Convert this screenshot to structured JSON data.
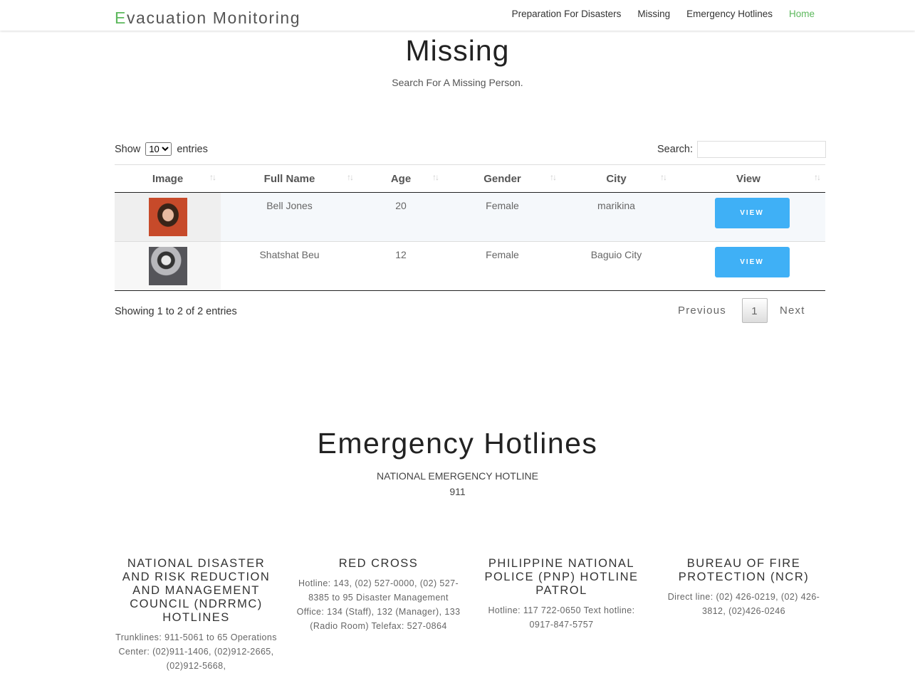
{
  "nav": {
    "brand_first": "E",
    "brand_rest": "vacuation Monitoring",
    "items": [
      "Preparation For Disasters",
      "Missing",
      "Emergency Hotlines",
      "Home"
    ],
    "active_color": "#5cb85c"
  },
  "missing": {
    "title": "Missing",
    "subtitle": "Search For A Missing Person.",
    "length": {
      "show": "Show",
      "entries": "entries",
      "selected": "10"
    },
    "search_label": "Search:",
    "columns": [
      "Image",
      "Full Name",
      "Age",
      "Gender",
      "City",
      "View"
    ],
    "rows": [
      {
        "name": "Bell  Jones",
        "age": "20",
        "gender": "Female",
        "city": "marikina",
        "view": "VIEW"
      },
      {
        "name": "Shatshat  Beu",
        "age": "12",
        "gender": "Female",
        "city": "Baguio City",
        "view": "VIEW"
      }
    ],
    "info": "Showing 1 to 2 of 2 entries",
    "pager": {
      "prev": "Previous",
      "page": "1",
      "next": "Next"
    }
  },
  "hotlines": {
    "title": "Emergency Hotlines",
    "national_label": "NATIONAL EMERGENCY HOTLINE",
    "national_number": "911",
    "agencies": [
      {
        "name": "NATIONAL DISASTER AND RISK REDUCTION AND MANAGEMENT COUNCIL (NDRRMC) HOTLINES",
        "details": "Trunklines: 911-5061 to 65 Operations Center: (02)911-1406, (02)912-2665, (02)912-5668,"
      },
      {
        "name": "RED CROSS",
        "details": "Hotline: 143, (02) 527-0000, (02) 527-8385 to 95 Disaster Management Office: 134 (Staff), 132 (Manager), 133 (Radio Room) Telefax: 527-0864"
      },
      {
        "name": "PHILIPPINE NATIONAL POLICE (PNP) HOTLINE PATROL",
        "details": "Hotline: 117 722-0650 Text hotline: 0917-847-5757"
      },
      {
        "name": "BUREAU OF FIRE PROTECTION (NCR)",
        "details": "Direct line: (02) 426-0219, (02) 426-3812, (02)426-0246"
      }
    ]
  }
}
